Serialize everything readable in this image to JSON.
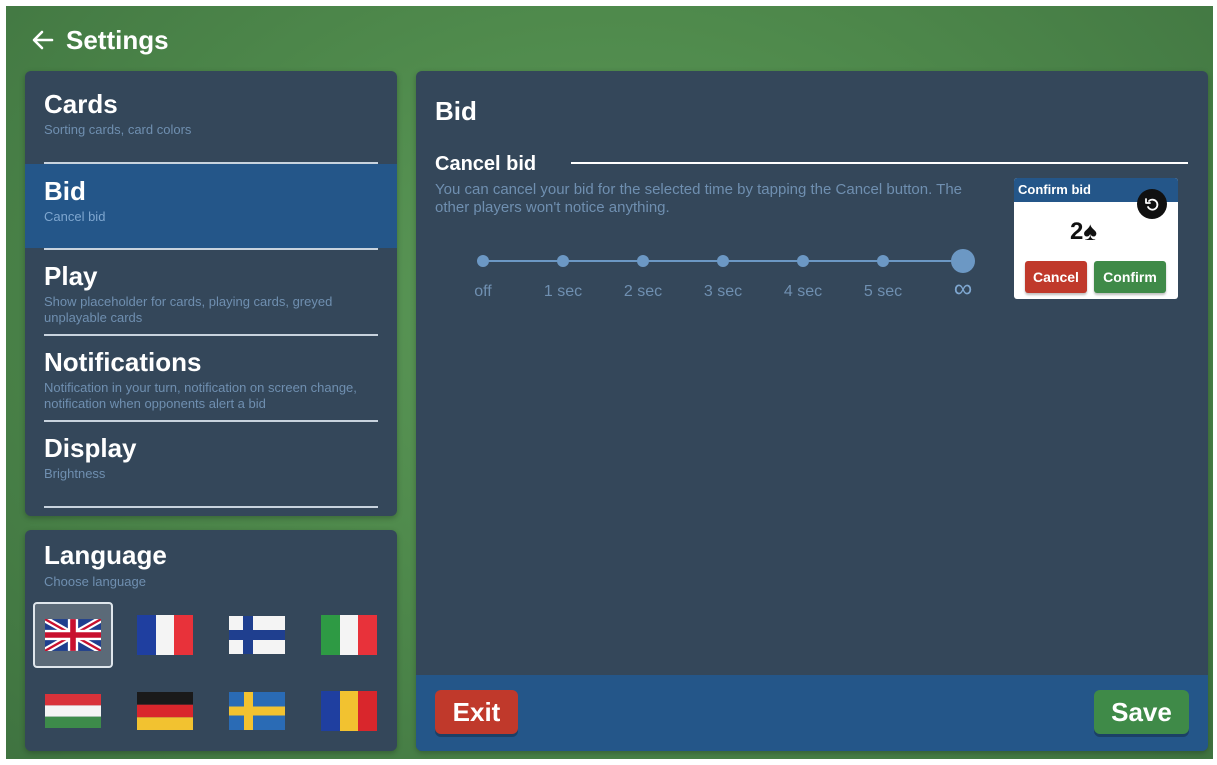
{
  "header": {
    "title": "Settings"
  },
  "nav": {
    "items": [
      {
        "title": "Cards",
        "subtitle": "Sorting cards, card colors"
      },
      {
        "title": "Bid",
        "subtitle": "Cancel bid"
      },
      {
        "title": "Play",
        "subtitle": "Show placeholder for cards, playing cards, greyed unplayable cards"
      },
      {
        "title": "Notifications",
        "subtitle": "Notification in your turn, notification on screen change, notification when opponents alert a bid"
      },
      {
        "title": "Display",
        "subtitle": "Brightness"
      }
    ],
    "active_index": 1
  },
  "language": {
    "title": "Language",
    "subtitle": "Choose language",
    "flags": [
      "uk-flag-icon",
      "france-flag-icon",
      "finland-flag-icon",
      "italy-flag-icon",
      "hungary-flag-icon",
      "germany-flag-icon",
      "sweden-flag-icon",
      "romania-flag-icon"
    ],
    "selected_index": 0
  },
  "main": {
    "title": "Bid",
    "section_title": "Cancel bid",
    "description": "You can cancel your bid for the selected time by tapping the Cancel button. The other players won't notice anything.",
    "slider": {
      "labels": [
        "off",
        "1 sec",
        "2 sec",
        "3 sec",
        "4 sec",
        "5 sec",
        "∞"
      ],
      "selected_index": 6
    },
    "preview": {
      "title": "Confirm bid",
      "bid_value": "2",
      "bid_suit": "♠",
      "cancel_label": "Cancel",
      "confirm_label": "Confirm"
    }
  },
  "footer": {
    "exit_label": "Exit",
    "save_label": "Save"
  },
  "colors": {
    "panel": "#34475a",
    "accent_blue": "#245689",
    "exit_red": "#c0392b",
    "save_green": "#3f8a48",
    "muted_text": "#6f8fb0"
  }
}
